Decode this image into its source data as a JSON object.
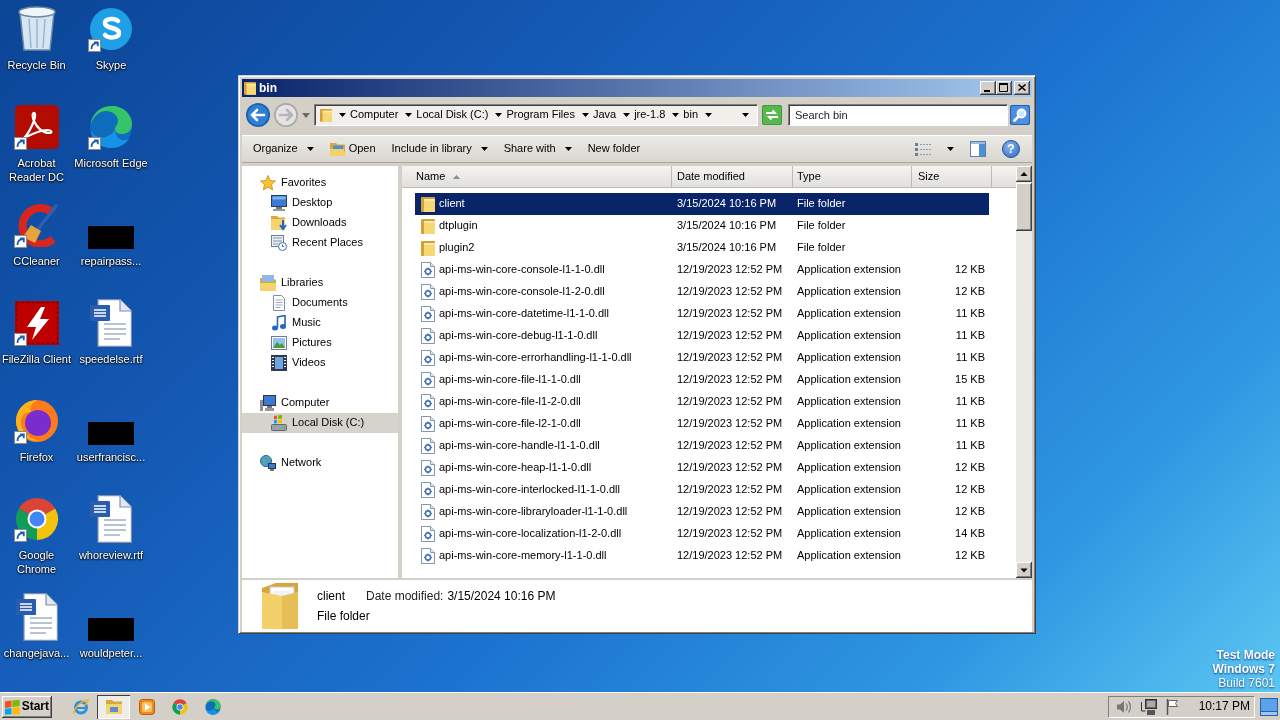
{
  "desktop": {
    "icons": [
      {
        "label": "Recycle Bin",
        "kind": "recycle-bin",
        "shortcut": false
      },
      {
        "label": "Skype",
        "kind": "skype",
        "shortcut": true
      },
      {
        "label": "Acrobat Reader DC",
        "kind": "acrobat",
        "shortcut": true
      },
      {
        "label": "Microsoft Edge",
        "kind": "edge",
        "shortcut": true
      },
      {
        "label": "CCleaner",
        "kind": "ccleaner",
        "shortcut": true
      },
      {
        "label": "repairpass...",
        "kind": "redacted",
        "shortcut": false
      },
      {
        "label": "FileZilla Client",
        "kind": "filezilla",
        "shortcut": true
      },
      {
        "label": "speedelse.rtf",
        "kind": "word-document",
        "shortcut": false
      },
      {
        "label": "Firefox",
        "kind": "firefox",
        "shortcut": true
      },
      {
        "label": "userfrancisc...",
        "kind": "redacted",
        "shortcut": false
      },
      {
        "label": "Google Chrome",
        "kind": "chrome",
        "shortcut": true
      },
      {
        "label": "whoreview.rtf",
        "kind": "word-document",
        "shortcut": false
      },
      {
        "label": "changejava...",
        "kind": "word-document",
        "shortcut": false
      },
      {
        "label": "wouldpeter...",
        "kind": "redacted",
        "shortcut": false
      }
    ],
    "os_info": [
      {
        "text": "Test Mode",
        "bold": true
      },
      {
        "text": "Windows 7",
        "bold": true
      },
      {
        "text": "Build 7601",
        "bold": false
      }
    ]
  },
  "window": {
    "title": "bin",
    "address_bar": {
      "crumbs": [
        "Computer",
        "Local Disk (C:)",
        "Program Files",
        "Java",
        "jre-1.8",
        "bin"
      ]
    },
    "search": {
      "placeholder": "Search bin"
    },
    "toolbar": {
      "items": [
        {
          "label": "Organize",
          "kind": "menu"
        },
        {
          "label": "Open",
          "kind": "open"
        },
        {
          "label": "Include in library",
          "kind": "menu"
        },
        {
          "label": "Share with",
          "kind": "menu"
        },
        {
          "label": "New folder",
          "kind": "plain"
        }
      ],
      "help": "?"
    },
    "nav_pane": {
      "groups": [
        {
          "label": "Favorites",
          "kind": "favorites",
          "selected": false,
          "children": [
            {
              "label": "Desktop",
              "kind": "desktop",
              "selected": false
            },
            {
              "label": "Downloads",
              "kind": "downloads",
              "selected": false
            },
            {
              "label": "Recent Places",
              "kind": "recent",
              "selected": false
            }
          ]
        },
        {
          "label": "Libraries",
          "kind": "libraries",
          "selected": false,
          "children": [
            {
              "label": "Documents",
              "kind": "documents",
              "selected": false
            },
            {
              "label": "Music",
              "kind": "music",
              "selected": false
            },
            {
              "label": "Pictures",
              "kind": "pictures",
              "selected": false
            },
            {
              "label": "Videos",
              "kind": "videos",
              "selected": false
            }
          ]
        },
        {
          "label": "Computer",
          "kind": "computer",
          "selected": false,
          "children": [
            {
              "label": "Local Disk (C:)",
              "kind": "disk",
              "selected": true
            }
          ]
        },
        {
          "label": "Network",
          "kind": "network",
          "selected": false
        }
      ]
    },
    "file_list": {
      "columns": [
        {
          "label": "Name",
          "sorted": true
        },
        {
          "label": "Date modified",
          "sorted": false
        },
        {
          "label": "Type",
          "sorted": false
        },
        {
          "label": "Size",
          "sorted": false
        }
      ],
      "rows": [
        {
          "name": "client",
          "kind": "folder",
          "date": "3/15/2024 10:16 PM",
          "type": "File folder",
          "selected": true
        },
        {
          "name": "dtplugin",
          "kind": "folder",
          "date": "3/15/2024 10:16 PM",
          "type": "File folder",
          "selected": false
        },
        {
          "name": "plugin2",
          "kind": "folder",
          "date": "3/15/2024 10:16 PM",
          "type": "File folder",
          "selected": false
        },
        {
          "name": "api-ms-win-core-console-l1-1-0.dll",
          "kind": "dll",
          "date": "12/19/2023 12:52 PM",
          "type": "Application extension",
          "size": "12 KB",
          "selected": false
        },
        {
          "name": "api-ms-win-core-console-l1-2-0.dll",
          "kind": "dll",
          "date": "12/19/2023 12:52 PM",
          "type": "Application extension",
          "size": "12 KB",
          "selected": false
        },
        {
          "name": "api-ms-win-core-datetime-l1-1-0.dll",
          "kind": "dll",
          "date": "12/19/2023 12:52 PM",
          "type": "Application extension",
          "size": "11 KB",
          "selected": false
        },
        {
          "name": "api-ms-win-core-debug-l1-1-0.dll",
          "kind": "dll",
          "date": "12/19/2023 12:52 PM",
          "type": "Application extension",
          "size": "11 KB",
          "selected": false
        },
        {
          "name": "api-ms-win-core-errorhandling-l1-1-0.dll",
          "kind": "dll",
          "date": "12/19/2023 12:52 PM",
          "type": "Application extension",
          "size": "11 KB",
          "selected": false
        },
        {
          "name": "api-ms-win-core-file-l1-1-0.dll",
          "kind": "dll",
          "date": "12/19/2023 12:52 PM",
          "type": "Application extension",
          "size": "15 KB",
          "selected": false
        },
        {
          "name": "api-ms-win-core-file-l1-2-0.dll",
          "kind": "dll",
          "date": "12/19/2023 12:52 PM",
          "type": "Application extension",
          "size": "11 KB",
          "selected": false
        },
        {
          "name": "api-ms-win-core-file-l2-1-0.dll",
          "kind": "dll",
          "date": "12/19/2023 12:52 PM",
          "type": "Application extension",
          "size": "11 KB",
          "selected": false
        },
        {
          "name": "api-ms-win-core-handle-l1-1-0.dll",
          "kind": "dll",
          "date": "12/19/2023 12:52 PM",
          "type": "Application extension",
          "size": "11 KB",
          "selected": false
        },
        {
          "name": "api-ms-win-core-heap-l1-1-0.dll",
          "kind": "dll",
          "date": "12/19/2023 12:52 PM",
          "type": "Application extension",
          "size": "12 KB",
          "selected": false
        },
        {
          "name": "api-ms-win-core-interlocked-l1-1-0.dll",
          "kind": "dll",
          "date": "12/19/2023 12:52 PM",
          "type": "Application extension",
          "size": "12 KB",
          "selected": false
        },
        {
          "name": "api-ms-win-core-libraryloader-l1-1-0.dll",
          "kind": "dll",
          "date": "12/19/2023 12:52 PM",
          "type": "Application extension",
          "size": "12 KB",
          "selected": false
        },
        {
          "name": "api-ms-win-core-localization-l1-2-0.dll",
          "kind": "dll",
          "date": "12/19/2023 12:52 PM",
          "type": "Application extension",
          "size": "14 KB",
          "selected": false
        },
        {
          "name": "api-ms-win-core-memory-l1-1-0.dll",
          "kind": "dll",
          "date": "12/19/2023 12:52 PM",
          "type": "Application extension",
          "size": "12 KB",
          "selected": false
        }
      ]
    },
    "details_pane": {
      "name": "client",
      "date_label": "Date modified:",
      "date": "3/15/2024 10:16 PM",
      "type": "File folder"
    }
  },
  "taskbar": {
    "start": "Start",
    "apps": [
      {
        "kind": "ie",
        "active": false
      },
      {
        "kind": "explorer",
        "active": true
      },
      {
        "kind": "media-player",
        "active": false
      },
      {
        "kind": "chrome",
        "active": false
      },
      {
        "kind": "edge",
        "active": false
      }
    ],
    "clock": "10:17 PM"
  }
}
